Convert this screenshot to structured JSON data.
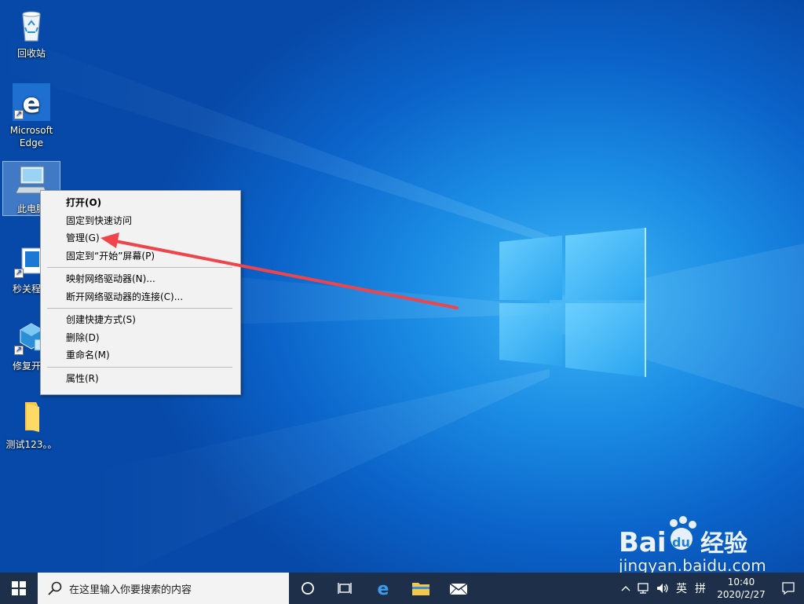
{
  "desktop": {
    "icons": [
      {
        "label": "回收站",
        "icon": "recycle-bin-icon"
      },
      {
        "label": "Microsoft Edge",
        "label_line1": "Microsoft",
        "label_line2": "Edge",
        "icon": "edge-icon"
      },
      {
        "label": "此电脑",
        "icon": "this-pc-icon"
      },
      {
        "label": "秒关程序",
        "icon": "app-shortcut-icon"
      },
      {
        "label": "修复开机",
        "icon": "repair-tool-icon"
      },
      {
        "label": "测试123。。",
        "icon": "folder-icon"
      }
    ]
  },
  "context_menu": {
    "items": [
      {
        "label": "打开(O)",
        "bold": true
      },
      {
        "label": "固定到快速访问"
      },
      {
        "label": "管理(G)"
      },
      {
        "label": "固定到“开始”屏幕(P)"
      },
      {
        "label": "映射网络驱动器(N)..."
      },
      {
        "label": "断开网络驱动器的连接(C)..."
      },
      {
        "label": "创建快捷方式(S)"
      },
      {
        "label": "删除(D)"
      },
      {
        "label": "重命名(M)"
      },
      {
        "label": "属性(R)"
      }
    ]
  },
  "taskbar": {
    "search_placeholder": "在这里输入你要搜索的内容",
    "pinned": [
      "task-view-icon",
      "edge-icon",
      "file-explorer-icon",
      "mail-icon"
    ],
    "tray": {
      "ime_lang": "英",
      "ime_mode": "拼",
      "time": "10:40",
      "date": "2020/2/27"
    },
    "accent_color": "#1d2f49"
  },
  "watermark": {
    "brand": "Baidu经验",
    "url": "jingyan.baidu.com"
  },
  "colors": {
    "annotation": "#f0444c",
    "desktop": "#0b63c9"
  }
}
